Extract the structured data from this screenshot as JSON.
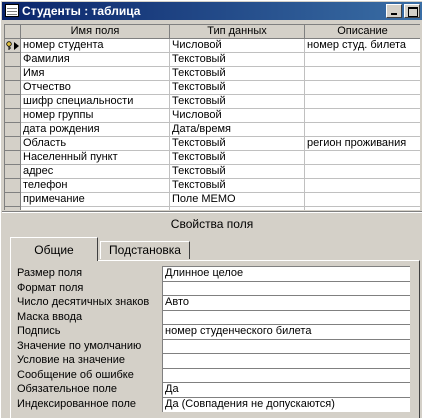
{
  "window": {
    "title": "Студенты : таблица"
  },
  "grid": {
    "headers": {
      "name": "Имя поля",
      "type": "Тип данных",
      "desc": "Описание"
    },
    "rows": [
      {
        "name": "номер студента",
        "type": "Числовой",
        "desc": "номер студ. билета"
      },
      {
        "name": "Фамилия",
        "type": "Текстовый",
        "desc": ""
      },
      {
        "name": "Имя",
        "type": "Текстовый",
        "desc": ""
      },
      {
        "name": "Отчество",
        "type": "Текстовый",
        "desc": ""
      },
      {
        "name": "шифр специальности",
        "type": "Текстовый",
        "desc": ""
      },
      {
        "name": "номер группы",
        "type": "Числовой",
        "desc": ""
      },
      {
        "name": "дата рождения",
        "type": "Дата/время",
        "desc": ""
      },
      {
        "name": "Область",
        "type": "Текстовый",
        "desc": "регион проживания"
      },
      {
        "name": "Населенный пункт",
        "type": "Текстовый",
        "desc": ""
      },
      {
        "name": "адрес",
        "type": "Текстовый",
        "desc": ""
      },
      {
        "name": "телефон",
        "type": "Текстовый",
        "desc": ""
      },
      {
        "name": "примечание",
        "type": "Поле MEMO",
        "desc": ""
      },
      {
        "name": "",
        "type": "",
        "desc": ""
      }
    ]
  },
  "props": {
    "title": "Свойства поля",
    "tabs": [
      "Общие",
      "Подстановка"
    ],
    "rows": [
      {
        "label": "Размер поля",
        "value": "Длинное целое"
      },
      {
        "label": "Формат поля",
        "value": ""
      },
      {
        "label": "Число десятичных знаков",
        "value": "Авто"
      },
      {
        "label": "Маска ввода",
        "value": ""
      },
      {
        "label": "Подпись",
        "value": "номер студенческого билета"
      },
      {
        "label": "Значение по умолчанию",
        "value": ""
      },
      {
        "label": "Условие на значение",
        "value": ""
      },
      {
        "label": "Сообщение об ошибке",
        "value": ""
      },
      {
        "label": "Обязательное поле",
        "value": "Да"
      },
      {
        "label": "Индексированное поле",
        "value": "Да (Совпадения не допускаются)"
      }
    ]
  }
}
